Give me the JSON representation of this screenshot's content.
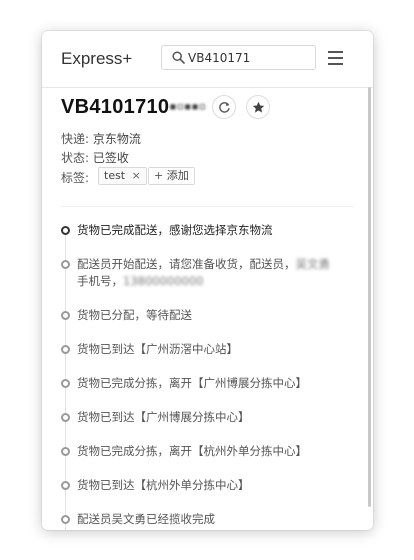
{
  "app": {
    "title": "Express+",
    "menu_icon": "hamburger-menu-icon"
  },
  "search": {
    "value": "VB410171",
    "icon": "search-icon"
  },
  "shipment": {
    "tracking_visible": "VB4101710",
    "tracking_masked": "▪▫▪▪▫",
    "courier_label": "快递:",
    "courier": "京东物流",
    "status_label": "状态:",
    "status": "已签收",
    "tags_label": "标签:",
    "tags": [
      "test"
    ],
    "add_tag": "添加",
    "refresh_icon": "refresh-icon",
    "star_icon": "star-icon"
  },
  "timeline": [
    {
      "text": "货物已完成配送，感谢您选择京东物流"
    },
    {
      "text": "配送员开始配送，请您准备收货，配送员，",
      "blur1": "吴文勇",
      "line2_prefix": "手机号，",
      "blur2": "13800000000"
    },
    {
      "text": "货物已分配，等待配送"
    },
    {
      "text": "货物已到达【广州沥滘中心站】"
    },
    {
      "text": "货物已完成分拣，离开【广州博展分拣中心】"
    },
    {
      "text": "货物已到达【广州博展分拣中心】"
    },
    {
      "text": "货物已完成分拣，离开【杭州外单分拣中心】"
    },
    {
      "text": "货物已到达【杭州外单分拣中心】"
    },
    {
      "text": "配送员吴文勇已经揽收完成"
    }
  ]
}
